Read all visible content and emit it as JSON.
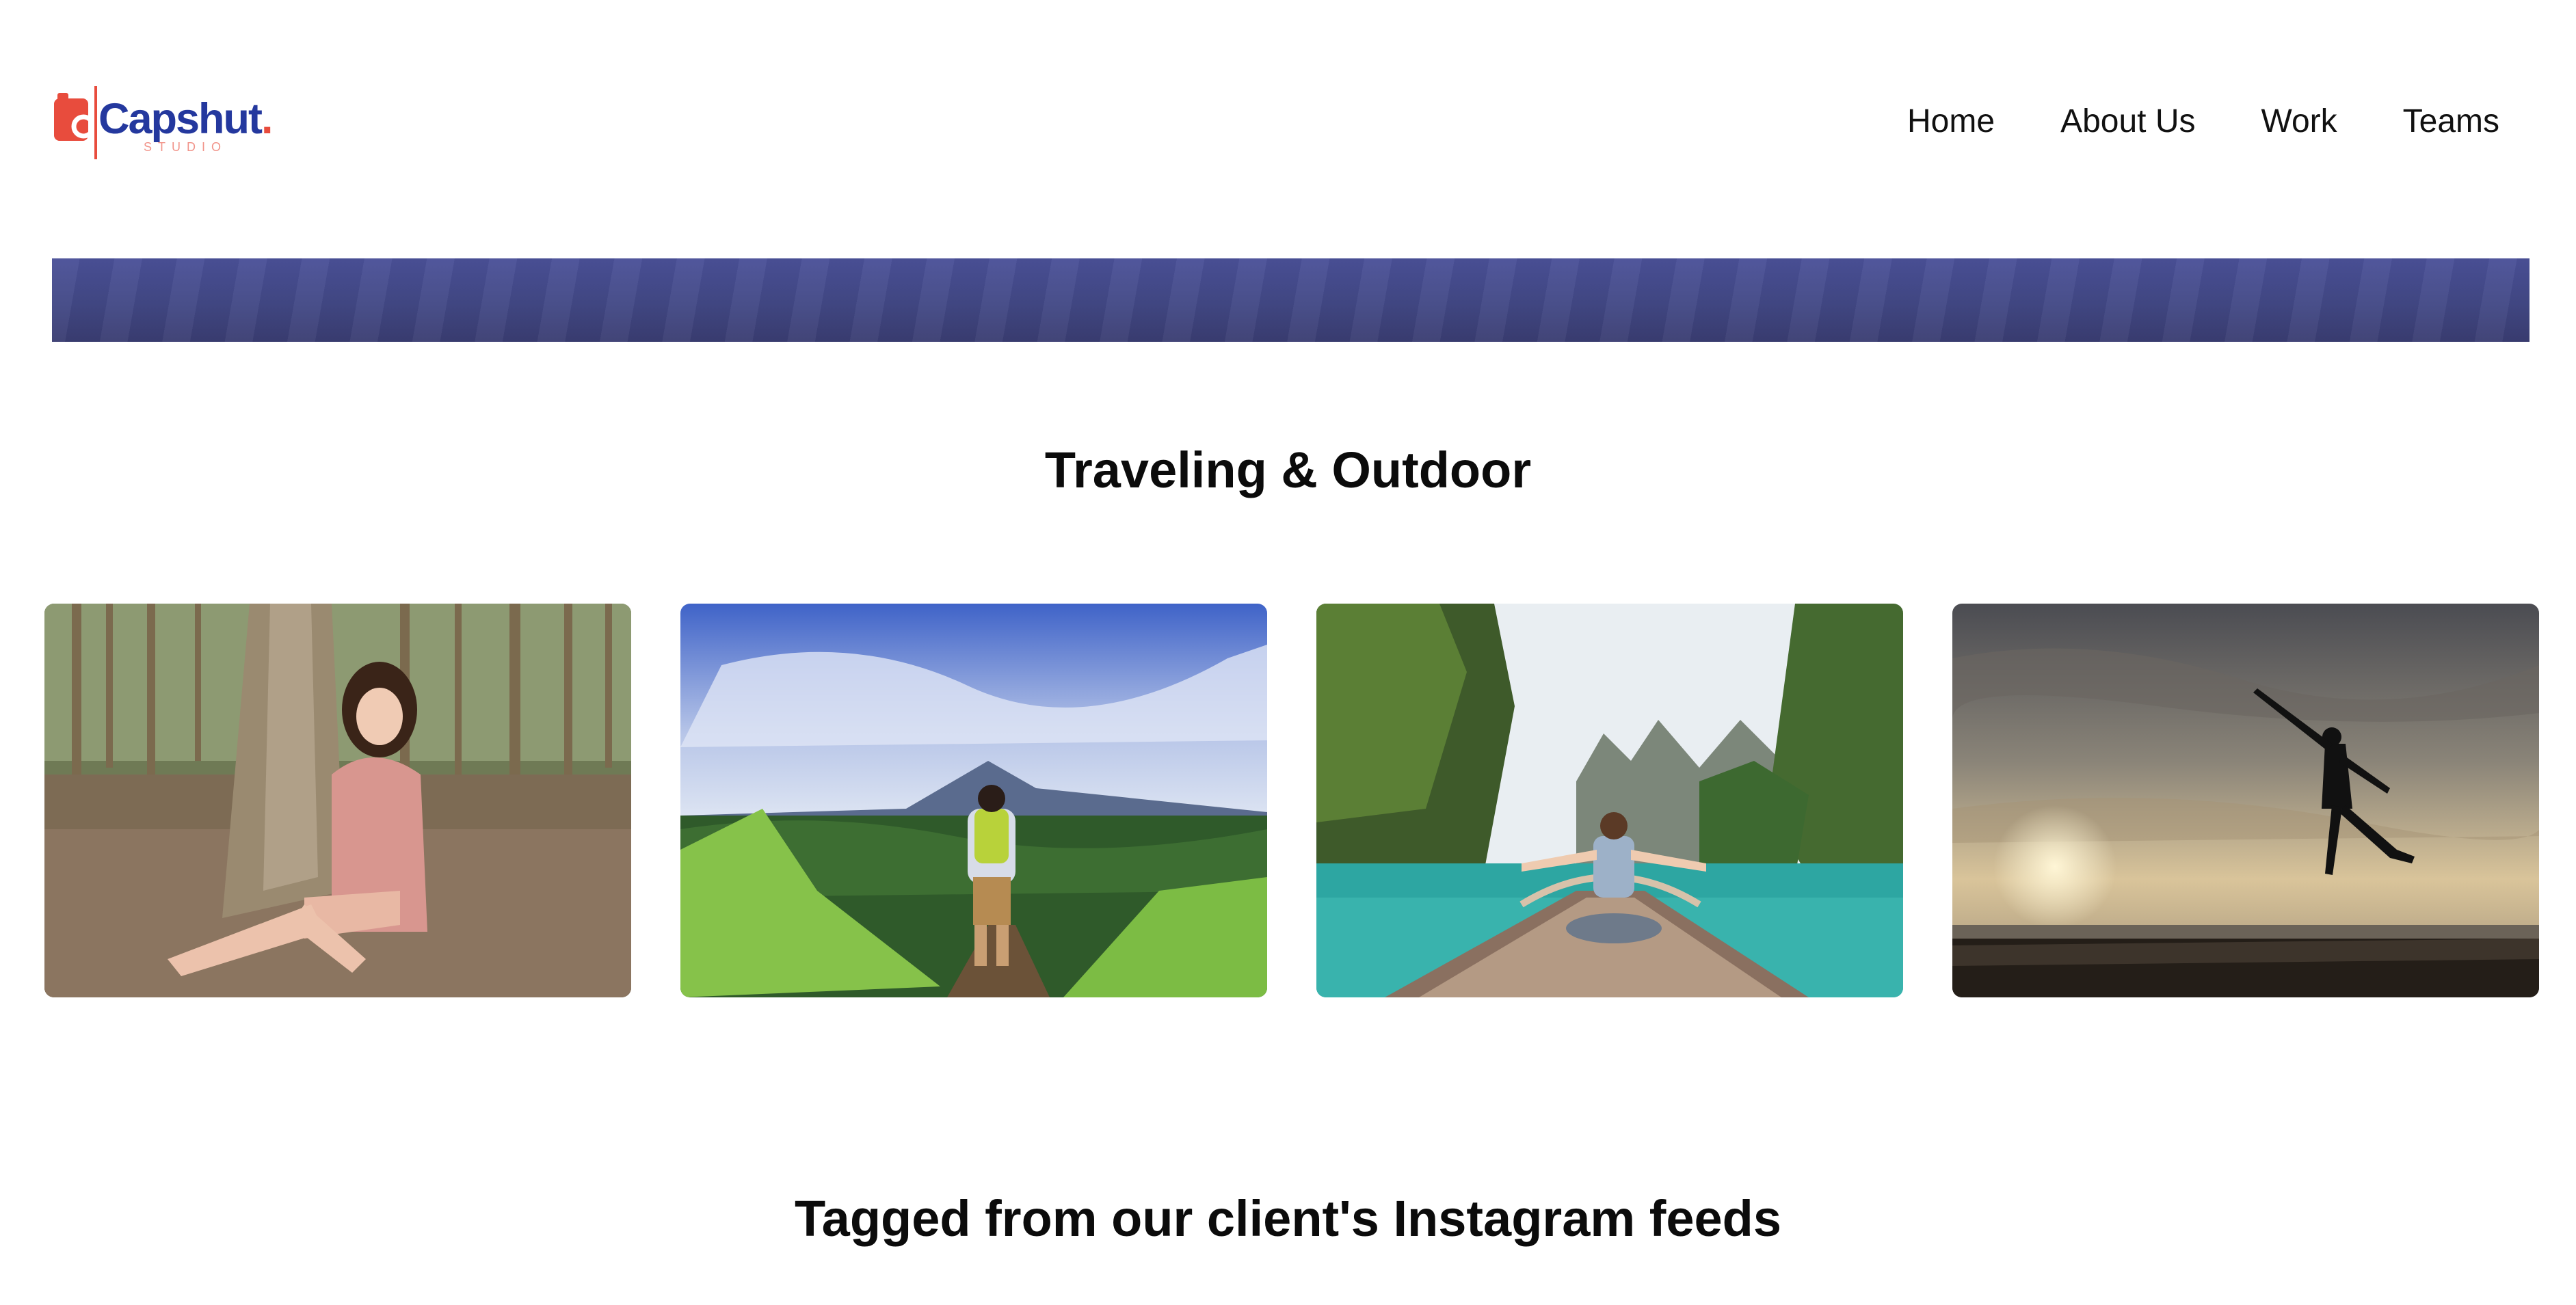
{
  "brand": {
    "name": "Capshut",
    "name_dot": ".",
    "tagline": "STUDIO",
    "primary_color": "#24389e",
    "accent_color": "#e84c3d"
  },
  "nav": {
    "items": [
      {
        "label": "Home"
      },
      {
        "label": "About Us"
      },
      {
        "label": "Work"
      },
      {
        "label": "Teams"
      }
    ]
  },
  "banner": {
    "color": "#424885"
  },
  "sections": {
    "travel": {
      "title": "Traveling & Outdoor"
    },
    "instagram": {
      "title": "Tagged from our client's Instagram feeds"
    }
  },
  "gallery": {
    "photos": [
      {
        "subject": "woman-sitting-by-tree-in-forest"
      },
      {
        "subject": "hiker-facing-volcano"
      },
      {
        "subject": "woman-on-boat-bow-among-limestone-cliffs"
      },
      {
        "subject": "silhouette-jumping-on-beach-at-sunset"
      }
    ]
  }
}
